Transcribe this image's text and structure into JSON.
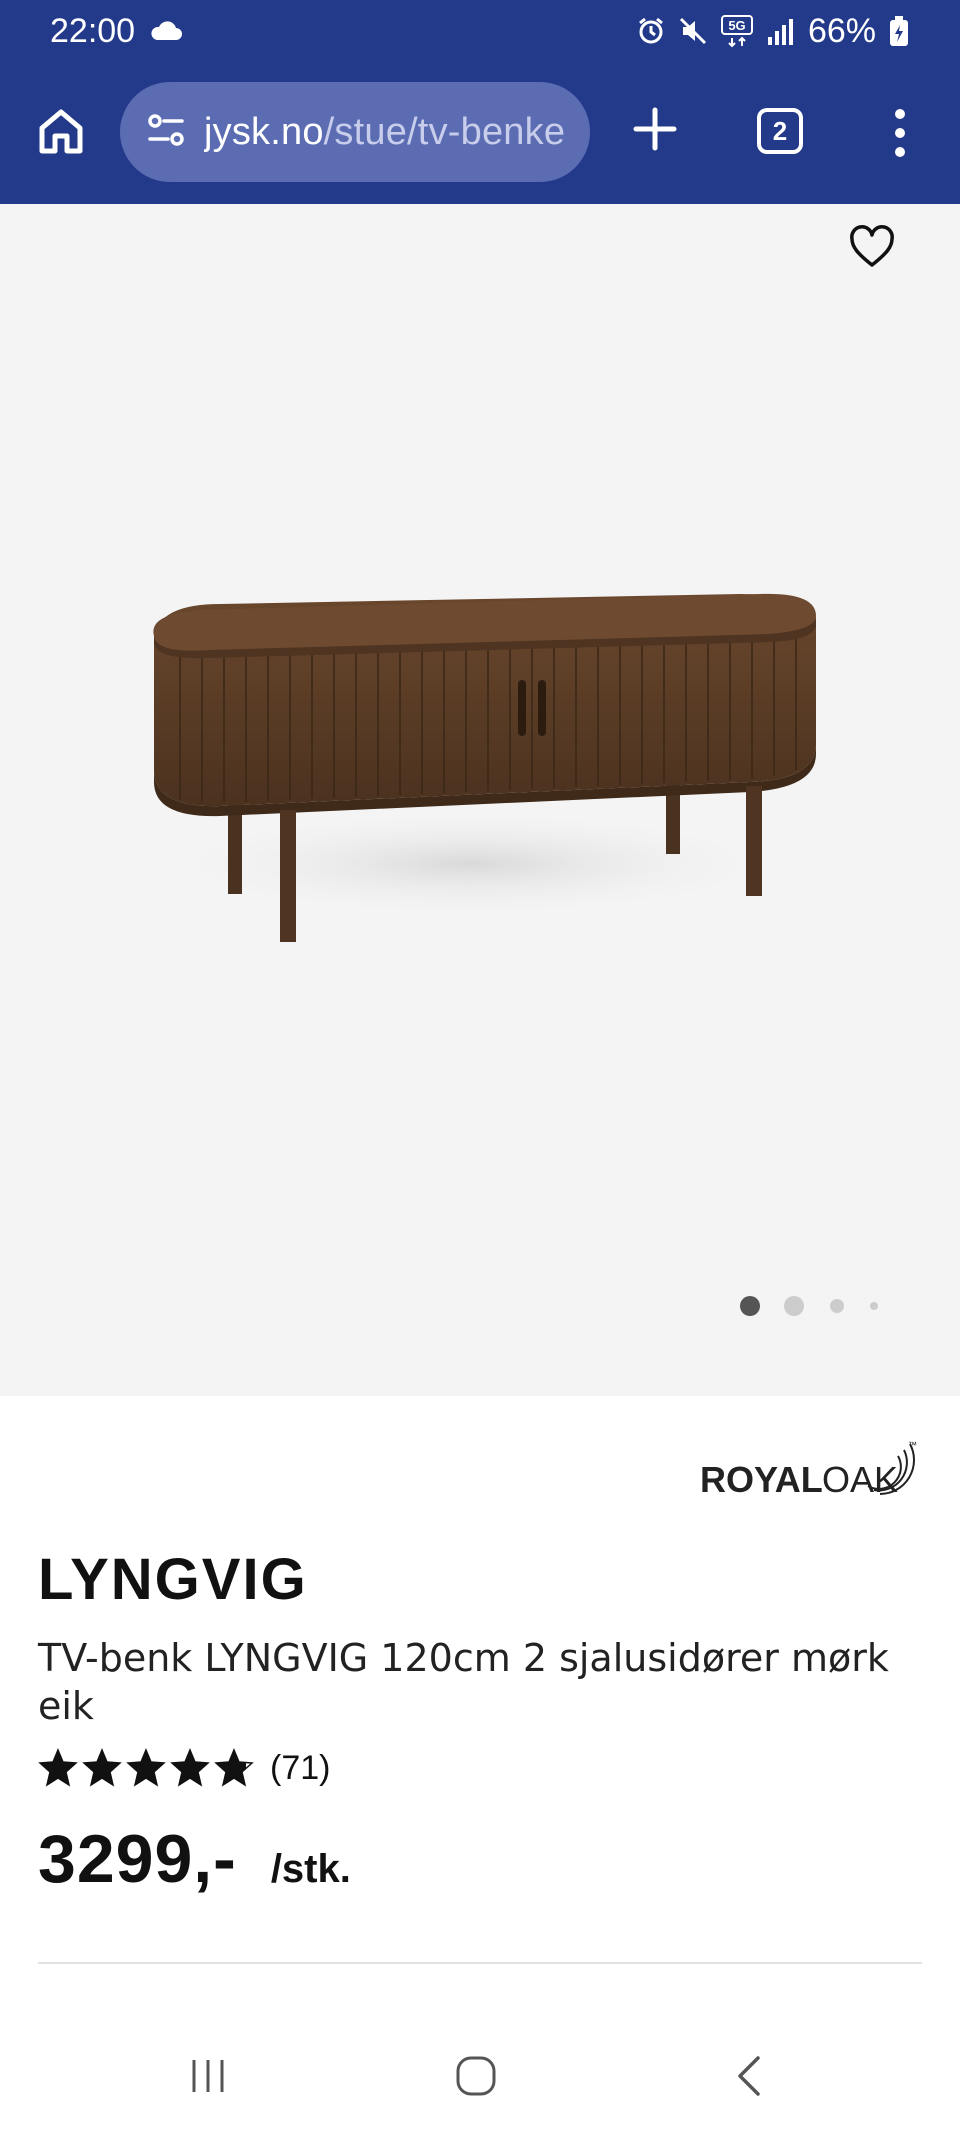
{
  "status_bar": {
    "time": "22:00",
    "battery": "66%",
    "network": "5G",
    "icons": [
      "cloud-icon",
      "alarm-icon",
      "mute-icon",
      "5g-icon",
      "signal-icon",
      "battery-icon"
    ]
  },
  "browser": {
    "url_host": "jysk.no",
    "url_path": "/stue/tv-benker",
    "tab_count": "2",
    "icons": [
      "home-icon",
      "site-settings-icon",
      "plus-icon",
      "tabs-icon",
      "more-vertical-icon"
    ]
  },
  "gallery": {
    "dot_count": 4,
    "active_index": 0,
    "icons": [
      "heart-icon"
    ]
  },
  "product": {
    "brand": "ROYALOAK",
    "brand_royal": "ROYAL",
    "brand_oak": "OAK",
    "brand_tm": "™",
    "name": "LYNGVIG",
    "description": "TV-benk LYNGVIG 120cm 2 sjalusidører mørk eik",
    "rating": 4.8,
    "rating_count": "(71)",
    "price": "3299,-",
    "unit": "/stk."
  },
  "colors": {
    "header_bg": "#233a8a",
    "url_pill_bg": "#5b6cb3",
    "hero_bg": "#f4f4f4",
    "wood": "#5e3f28"
  },
  "system_nav": {
    "icons": [
      "recent-apps-icon",
      "home-circle-icon",
      "back-icon"
    ]
  }
}
